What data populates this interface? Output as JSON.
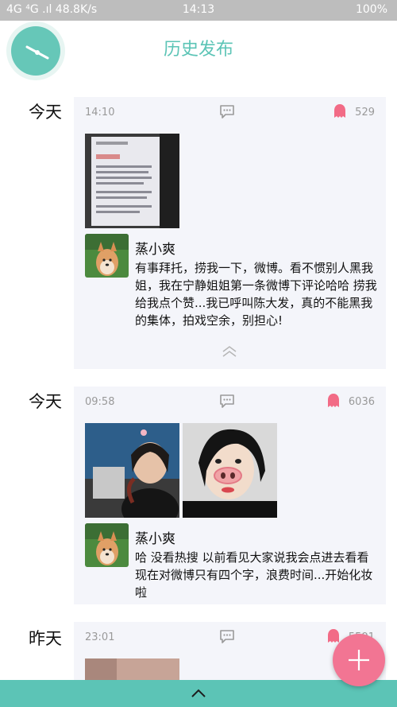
{
  "status_bar": {
    "left": "4G  ⁴G  .ıl 48.8K/s",
    "time": "14:13",
    "battery": "100%"
  },
  "header": {
    "title": "历史发布"
  },
  "posts": [
    {
      "day": "今天",
      "time": "14:10",
      "likes": "529",
      "author": "蒸小爽",
      "text": "有事拜托，捞我一下，微博。看不惯别人黑我姐，我在宁静姐姐第一条微博下评论哈哈 捞我 给我点个赞...我已呼叫陈大发，真的不能黑我的集体，拍戏空余，别担心!"
    },
    {
      "day": "今天",
      "time": "09:58",
      "likes": "6036",
      "author": "蒸小爽",
      "text": "哈 没看热搜 以前看见大家说我会点进去看看 现在对微博只有四个字，浪费时间...开始化妆啦"
    },
    {
      "day": "昨天",
      "time": "23:01",
      "likes": "5591"
    }
  ],
  "colors": {
    "accent": "#5cc4b6",
    "fab": "#f27593",
    "like": "#f26b86"
  }
}
